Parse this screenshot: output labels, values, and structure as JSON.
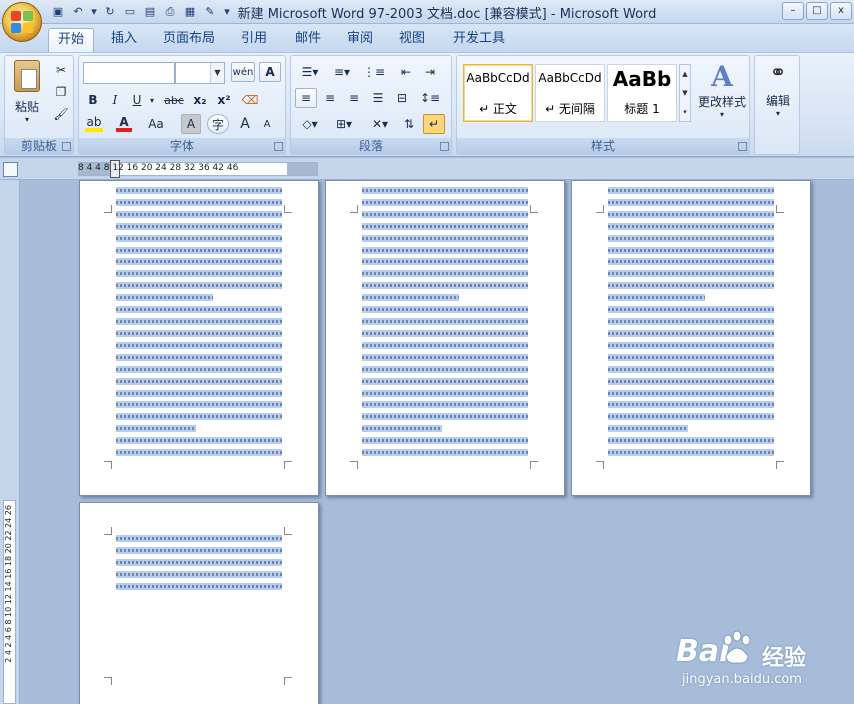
{
  "window": {
    "title": "新建 Microsoft Word 97-2003 文档.doc [兼容模式] - Microsoft Word",
    "controls": {
      "minimize": "–",
      "maximize": "□",
      "close": "x"
    }
  },
  "tabs": [
    "开始",
    "插入",
    "页面布局",
    "引用",
    "邮件",
    "审阅",
    "视图",
    "开发工具"
  ],
  "active_tab": "开始",
  "ribbon": {
    "clipboard": {
      "label": "剪贴板",
      "paste": "粘贴"
    },
    "font": {
      "label": "字体",
      "wen_button": "wén",
      "a_button": "A",
      "bold": "B",
      "italic": "I",
      "underline": "U",
      "strike": "abc",
      "subscript": "x₂",
      "superscript": "x²",
      "case": "Aa",
      "char_shading": "A",
      "enclose": "字",
      "grow": "A",
      "shrink": "A"
    },
    "paragraph": {
      "label": "段落"
    },
    "styles": {
      "label": "样式",
      "cards": [
        {
          "sample": "AaBbCcDd",
          "name": "↵ 正文"
        },
        {
          "sample": "AaBbCcDd",
          "name": "↵ 无间隔"
        },
        {
          "sample": "AaBb",
          "name": "标题 1"
        }
      ],
      "change_styles": "更改样式"
    },
    "editing": {
      "label": "编辑"
    }
  },
  "ruler": {
    "ticks": "8   4       4   8  12  16  20  24  28  32  36     42  46",
    "vticks": "2   4       2   4   6   8  10  12  14  16  18  20  22  24  26"
  },
  "watermark": {
    "brand": "Bai",
    "cn": "经验",
    "url": "jingyan.baidu.com"
  },
  "colors": {
    "selection": "#b5cdf0",
    "workspace": "#a6bcd9",
    "ribbon": "#dae6f6"
  }
}
